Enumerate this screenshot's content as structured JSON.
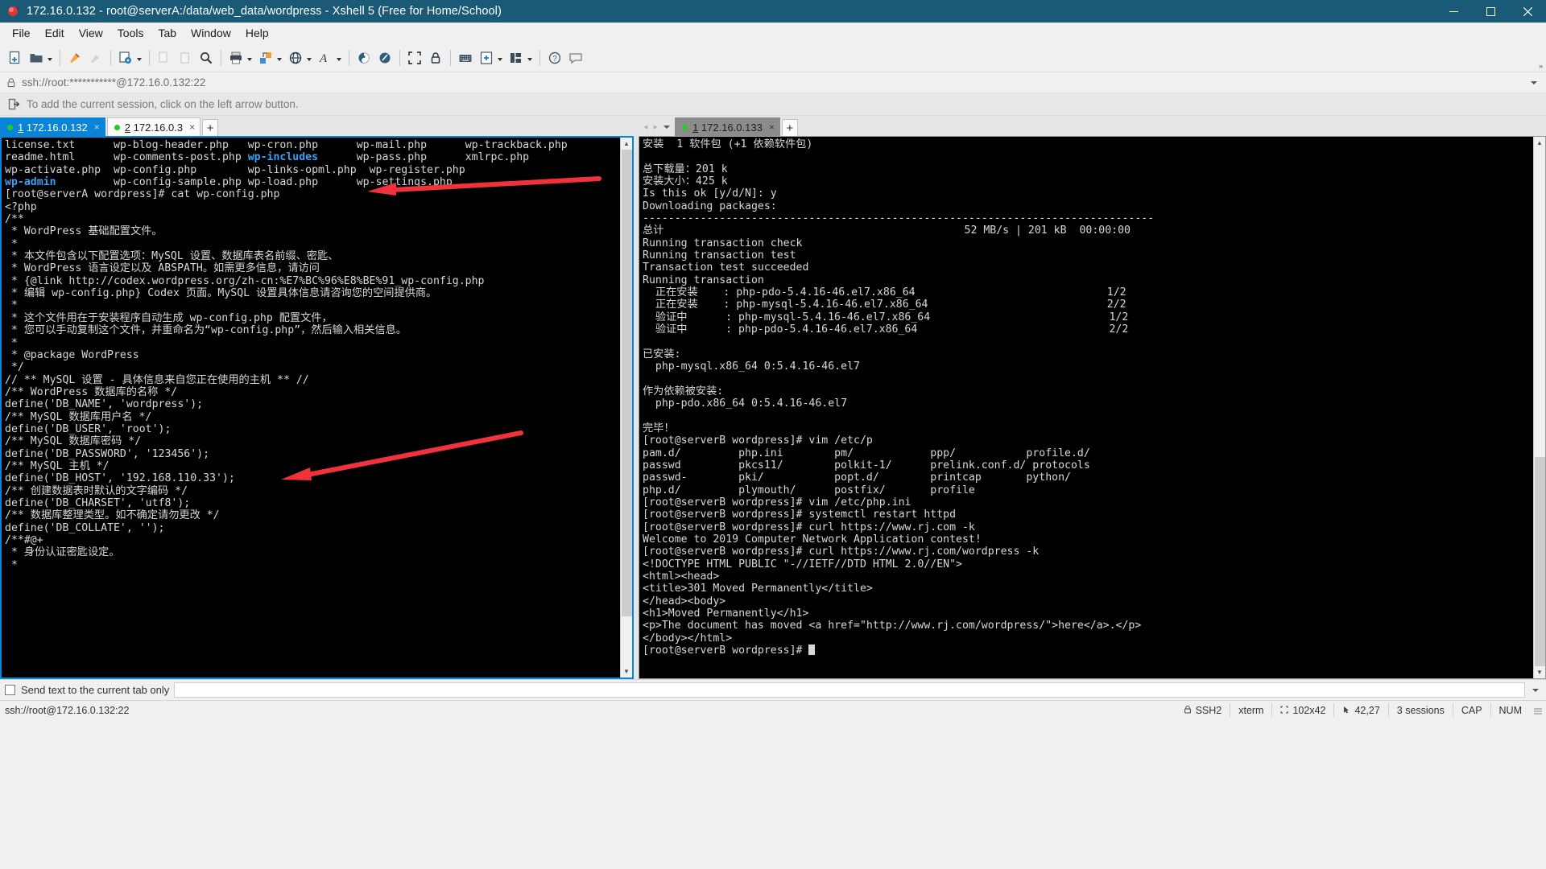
{
  "window": {
    "title": "172.16.0.132 - root@serverA:/data/web_data/wordpress - Xshell 5 (Free for Home/School)",
    "app_icon": "xshell-icon",
    "minimize_label": "Minimize",
    "maximize_label": "Maximize",
    "close_label": "Close",
    "titlebar_color": "#1b5a77"
  },
  "menu": {
    "items": [
      {
        "label": "File",
        "name": "menu-file"
      },
      {
        "label": "Edit",
        "name": "menu-edit"
      },
      {
        "label": "View",
        "name": "menu-view"
      },
      {
        "label": "Tools",
        "name": "menu-tools"
      },
      {
        "label": "Tab",
        "name": "menu-tab"
      },
      {
        "label": "Window",
        "name": "menu-window"
      },
      {
        "label": "Help",
        "name": "menu-help"
      }
    ]
  },
  "toolbar": {
    "overflow_label": "»",
    "items": [
      {
        "icon": "new-session-icon",
        "label": "New Session",
        "dropdown": false,
        "disabled": false
      },
      {
        "icon": "open-folder-icon",
        "label": "Open",
        "dropdown": true,
        "disabled": false
      },
      {
        "sep": true
      },
      {
        "icon": "connect-icon",
        "label": "Connect",
        "dropdown": false,
        "disabled": false
      },
      {
        "icon": "disconnect-icon",
        "label": "Disconnect",
        "dropdown": false,
        "disabled": true
      },
      {
        "sep": true
      },
      {
        "icon": "properties-icon",
        "label": "Properties",
        "dropdown": true,
        "disabled": false
      },
      {
        "sep": true
      },
      {
        "icon": "copy-icon",
        "label": "Copy",
        "dropdown": false,
        "disabled": true
      },
      {
        "icon": "paste-icon",
        "label": "Paste",
        "dropdown": false,
        "disabled": true
      },
      {
        "icon": "find-icon",
        "label": "Find",
        "dropdown": false,
        "disabled": false
      },
      {
        "sep": true
      },
      {
        "icon": "print-icon",
        "label": "Print",
        "dropdown": true,
        "disabled": false
      },
      {
        "icon": "transfer-icon",
        "label": "File Transfer",
        "dropdown": true,
        "disabled": false
      },
      {
        "icon": "globe-icon",
        "label": "Tunneling",
        "dropdown": true,
        "disabled": false
      },
      {
        "icon": "font-icon",
        "label": "Font",
        "dropdown": true,
        "disabled": false
      },
      {
        "sep": true
      },
      {
        "icon": "log-icon",
        "label": "Log",
        "dropdown": false,
        "disabled": false
      },
      {
        "icon": "record-icon",
        "label": "Record Script",
        "dropdown": false,
        "disabled": false
      },
      {
        "sep": true
      },
      {
        "icon": "fullscreen-icon",
        "label": "Full Screen",
        "dropdown": false,
        "disabled": false
      },
      {
        "icon": "lock-icon",
        "label": "Lock",
        "dropdown": false,
        "disabled": false
      },
      {
        "sep": true
      },
      {
        "icon": "keyboard-icon",
        "label": "Compose Bar",
        "dropdown": false,
        "disabled": false
      },
      {
        "icon": "add-pane-icon",
        "label": "New Pane",
        "dropdown": true,
        "disabled": false
      },
      {
        "icon": "layout-icon",
        "label": "Arrange Layout",
        "dropdown": true,
        "disabled": false
      },
      {
        "sep": true
      },
      {
        "icon": "help-icon",
        "label": "Help",
        "dropdown": false,
        "disabled": false
      },
      {
        "icon": "feedback-icon",
        "label": "Feedback",
        "dropdown": false,
        "disabled": false
      }
    ]
  },
  "address_bar": {
    "lock_icon": "lock-icon",
    "url": "ssh://root:***********@172.16.0.132:22",
    "dropdown_icon": "chevron-down-icon"
  },
  "hint_bar": {
    "icon": "add-session-icon",
    "text": "To add the current session, click on the left arrow button."
  },
  "panes": {
    "left": {
      "tabs": [
        {
          "index": "1",
          "label": "172.16.0.132",
          "active": true,
          "status": "connected",
          "close": "×"
        },
        {
          "index": "2",
          "label": "172.16.0.3",
          "active": false,
          "status": "connected",
          "close": "×"
        }
      ],
      "new_tab_label": "+",
      "terminal_lines": [
        [
          {
            "t": "license.txt      "
          },
          {
            "t": "wp-blog-header.php   "
          },
          {
            "t": "wp-cron.php      "
          },
          {
            "t": "wp-mail.php      "
          },
          {
            "t": "wp-trackback.php"
          }
        ],
        [
          {
            "t": "readme.html      "
          },
          {
            "t": "wp-comments-post.php "
          },
          {
            "t": "wp-includes",
            "c": "dir"
          },
          {
            "t": "      wp-pass.php      "
          },
          {
            "t": "xmlrpc.php"
          }
        ],
        [
          {
            "t": "wp-activate.php  "
          },
          {
            "t": "wp-config.php        "
          },
          {
            "t": "wp-links-opml.php"
          },
          {
            "t": "  wp-register.php"
          }
        ],
        [
          {
            "t": "wp-admin",
            "c": "dir"
          },
          {
            "t": "         wp-config-sample.php "
          },
          {
            "t": "wp-load.php      "
          },
          {
            "t": "wp-settings.php"
          }
        ],
        [
          {
            "t": "[root@serverA wordpress]# cat wp-config.php"
          }
        ],
        [
          {
            "t": "<?php"
          }
        ],
        [
          {
            "t": "/**"
          }
        ],
        [
          {
            "t": " * WordPress 基础配置文件。"
          }
        ],
        [
          {
            "t": " *"
          }
        ],
        [
          {
            "t": " * 本文件包含以下配置选项：MySQL 设置、数据库表名前缀、密匙、"
          }
        ],
        [
          {
            "t": " * WordPress 语言设定以及 ABSPATH。如需更多信息，请访问"
          }
        ],
        [
          {
            "t": " * {@link http://codex.wordpress.org/zh-cn:%E7%BC%96%E8%BE%91_wp-config.php"
          }
        ],
        [
          {
            "t": " * 编辑 wp-config.php} Codex 页面。MySQL 设置具体信息请咨询您的空间提供商。"
          }
        ],
        [
          {
            "t": " *"
          }
        ],
        [
          {
            "t": " * 这个文件用在于安装程序自动生成 wp-config.php 配置文件，"
          }
        ],
        [
          {
            "t": " * 您可以手动复制这个文件，并重命名为“wp-config.php”，然后输入相关信息。"
          }
        ],
        [
          {
            "t": " *"
          }
        ],
        [
          {
            "t": " * @package WordPress"
          }
        ],
        [
          {
            "t": " */"
          }
        ],
        [
          {
            "t": ""
          }
        ],
        [
          {
            "t": "// ** MySQL 设置 - 具体信息来自您正在使用的主机 ** //"
          }
        ],
        [
          {
            "t": "/** WordPress 数据库的名称 */"
          }
        ],
        [
          {
            "t": "define('DB_NAME', 'wordpress');"
          }
        ],
        [
          {
            "t": ""
          }
        ],
        [
          {
            "t": "/** MySQL 数据库用户名 */"
          }
        ],
        [
          {
            "t": "define('DB_USER', 'root');"
          }
        ],
        [
          {
            "t": ""
          }
        ],
        [
          {
            "t": "/** MySQL 数据库密码 */"
          }
        ],
        [
          {
            "t": "define('DB_PASSWORD', '123456');"
          }
        ],
        [
          {
            "t": ""
          }
        ],
        [
          {
            "t": "/** MySQL 主机 */"
          }
        ],
        [
          {
            "t": "define('DB_HOST', '192.168.110.33');"
          }
        ],
        [
          {
            "t": ""
          }
        ],
        [
          {
            "t": "/** 创建数据表时默认的文字编码 */"
          }
        ],
        [
          {
            "t": "define('DB_CHARSET', 'utf8');"
          }
        ],
        [
          {
            "t": ""
          }
        ],
        [
          {
            "t": "/** 数据库整理类型。如不确定请勿更改 */"
          }
        ],
        [
          {
            "t": "define('DB_COLLATE', '');"
          }
        ],
        [
          {
            "t": ""
          }
        ],
        [
          {
            "t": "/**#@+"
          }
        ],
        [
          {
            "t": " * 身份认证密匙设定。"
          }
        ],
        [
          {
            "t": " *"
          }
        ]
      ]
    },
    "right": {
      "nav": {
        "prev": "◂",
        "next": "▸",
        "menu": "chevron-down-icon"
      },
      "tabs": [
        {
          "index": "1",
          "label": "172.16.0.133",
          "active": true,
          "status": "connected",
          "close": "×"
        }
      ],
      "new_tab_label": "+",
      "terminal_lines": [
        "安装  1 软件包 (+1 依赖软件包)",
        "",
        "总下载量：201 k",
        "安装大小：425 k",
        "Is this ok [y/d/N]: y",
        "Downloading packages:",
        "--------------------------------------------------------------------------------",
        "总计                                               52 MB/s | 201 kB  00:00:00",
        "Running transaction check",
        "Running transaction test",
        "Transaction test succeeded",
        "Running transaction",
        "  正在安装    : php-pdo-5.4.16-46.el7.x86_64                              1/2",
        "  正在安装    : php-mysql-5.4.16-46.el7.x86_64                            2/2",
        "  验证中      : php-mysql-5.4.16-46.el7.x86_64                            1/2",
        "  验证中      : php-pdo-5.4.16-46.el7.x86_64                              2/2",
        "",
        "已安装:",
        "  php-mysql.x86_64 0:5.4.16-46.el7",
        "",
        "作为依赖被安装:",
        "  php-pdo.x86_64 0:5.4.16-46.el7",
        "",
        "完毕！",
        "[root@serverB wordpress]# vim /etc/p",
        "pam.d/         php.ini        pm/            ppp/           profile.d/",
        "passwd         pkcs11/        polkit-1/      prelink.conf.d/ protocols",
        "passwd-        pki/           popt.d/        printcap       python/",
        "php.d/         plymouth/      postfix/       profile",
        "[root@serverB wordpress]# vim /etc/php.ini",
        "[root@serverB wordpress]# systemctl restart httpd",
        "[root@serverB wordpress]# curl https://www.rj.com -k",
        "Welcome to 2019 Computer Network Application contest!",
        "[root@serverB wordpress]# curl https://www.rj.com/wordpress -k",
        "<!DOCTYPE HTML PUBLIC \"-//IETF//DTD HTML 2.0//EN\">",
        "<html><head>",
        "<title>301 Moved Permanently</title>",
        "</head><body>",
        "<h1>Moved Permanently</h1>",
        "<p>The document has moved <a href=\"http://www.rj.com/wordpress/\">here</a>.</p>",
        "</body></html>",
        "[root@serverB wordpress]# "
      ]
    }
  },
  "annotations": {
    "color": "#f0323c",
    "arrows": [
      {
        "name": "annotation-arrow-php-line",
        "target": "php-opening-tag"
      },
      {
        "name": "annotation-arrow-db-password",
        "target": "db-password-define"
      }
    ]
  },
  "send_bar": {
    "checkbox_checked": false,
    "label": "Send text to the current tab only",
    "input_value": "",
    "dropdown_icon": "chevron-down-icon"
  },
  "status_bar": {
    "connection": "ssh://root@172.16.0.132:22",
    "protocol_icon": "lock-icon",
    "protocol": "SSH2",
    "terminal_type": "xterm",
    "size_icon": "resize-icon",
    "size": "102x42",
    "cursor_icon": "cursor-icon",
    "cursor": "42,27",
    "sessions": "3 sessions",
    "caps": "CAP",
    "num": "NUM",
    "grip": "resize-grip"
  }
}
